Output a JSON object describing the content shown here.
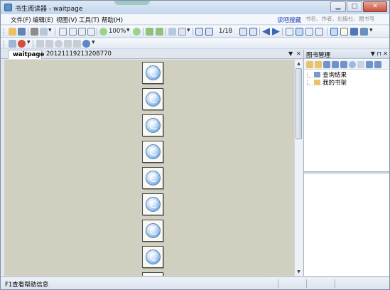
{
  "window": {
    "title": "书生阅读器 - waitpage"
  },
  "menu": {
    "items": [
      "文件(F)",
      "编辑(E)",
      "视图(V)",
      "工具(T)",
      "帮助(H)"
    ],
    "link": "读吧搜藏",
    "search_placeholder": "书名、作者、出版社、图书号"
  },
  "toolbar": {
    "zoom": "100%",
    "page": "1/18"
  },
  "tabs": {
    "active": "waitpage",
    "inactive": "20121119213208770"
  },
  "panel": {
    "title": "图书管理",
    "tree": [
      "查询结果",
      "我的书架"
    ]
  },
  "statusbar": {
    "text": "F1查看帮助信息"
  },
  "document": {
    "thumbnail_count": 8
  }
}
